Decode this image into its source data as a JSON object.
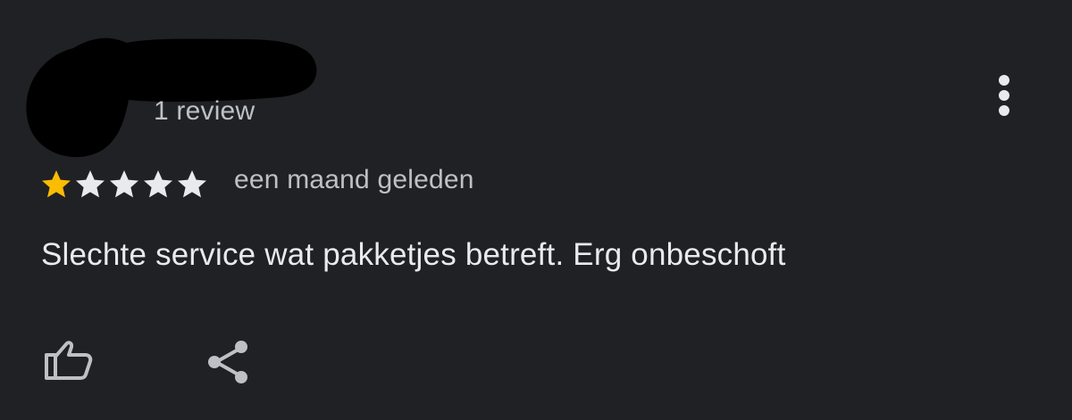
{
  "reviewer": {
    "name": "",
    "review_count": "1 review",
    "avatar_redacted": true
  },
  "review": {
    "rating": 1,
    "max_rating": 5,
    "date": "een maand geleden",
    "text": "Slechte service wat pakketjes betreft. Erg onbeschoft"
  },
  "actions": {
    "like_icon": "thumbs-up-icon",
    "share_icon": "share-icon",
    "more_icon": "more-vert-icon"
  },
  "colors": {
    "background": "#202124",
    "text_primary": "#e8eaed",
    "text_secondary": "#bdc1c6",
    "star_filled": "#fbbc04",
    "star_empty": "#e8eaed"
  }
}
